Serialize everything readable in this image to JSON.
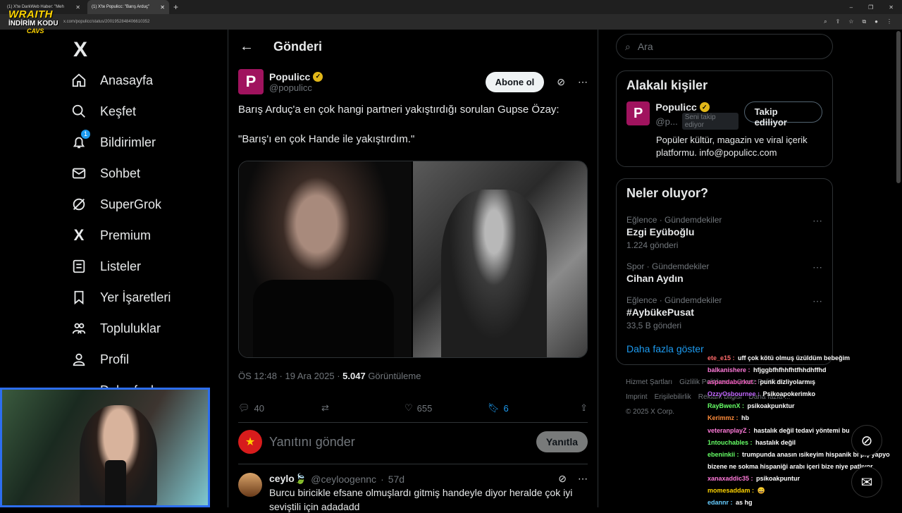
{
  "browser": {
    "tabs": [
      {
        "title": "(1) X'te DarkWeb Haber: \"Meh"
      },
      {
        "title": "(1) X'te Populicc: \"Barış Arduç\""
      }
    ],
    "url": "x.com/populicc/status/2001952848406610352"
  },
  "nav": {
    "logo": "X",
    "items": [
      {
        "label": "Anasayfa",
        "icon": "home-icon"
      },
      {
        "label": "Keşfet",
        "icon": "search-icon"
      },
      {
        "label": "Bildirimler",
        "icon": "bell-icon",
        "badge": "1"
      },
      {
        "label": "Sohbet",
        "icon": "mail-icon"
      },
      {
        "label": "SuperGrok",
        "icon": "grok-icon"
      },
      {
        "label": "Premium",
        "icon": "x-icon"
      },
      {
        "label": "Listeler",
        "icon": "list-icon"
      },
      {
        "label": "Yer İşaretleri",
        "icon": "bookmark-icon"
      },
      {
        "label": "Topluluklar",
        "icon": "people-icon"
      },
      {
        "label": "Profil",
        "icon": "person-icon"
      },
      {
        "label": "Daha fazla",
        "icon": "more-icon"
      }
    ]
  },
  "header": {
    "title": "Gönderi"
  },
  "post": {
    "author_name": "Populicc",
    "author_handle": "@populicc",
    "subscribe_label": "Abone ol",
    "text_line1": "Barış Arduç'a en çok hangi partneri yakıştırdığı sorulan Gupse Özay:",
    "text_line2": "\"Barış'ı en çok Hande ile yakıştırdım.\"",
    "time": "ÖS 12:48 · 19 Ara 2025 · ",
    "views_count": "5.047",
    "views_label": " Görüntüleme",
    "replies": "40",
    "reposts": "",
    "likes": "655",
    "bookmarks": "6"
  },
  "reply_box": {
    "placeholder": "Yanıtını gönder",
    "button": "Yanıtla"
  },
  "comment": {
    "name": "ceylo🍃",
    "handle": "@ceyloogennc",
    "age": "57d",
    "text": "Burcu biricikle efsane olmuşlardı gitmiş handeyle diyor heralde çok iyi",
    "text2": "seviştili için adadadd"
  },
  "right": {
    "search_placeholder": "Ara",
    "related_title": "Alakalı kişiler",
    "related": {
      "name": "Populicc",
      "handle": "@p...",
      "follows_you": "Seni takip ediyor",
      "follow_label": "Takip ediliyor",
      "bio": "Popüler kültür, magazin ve viral içerik platformu. info@populicc.com"
    },
    "trends_title": "Neler oluyor?",
    "trends": [
      {
        "category": "Eğlence · Gündemdekiler",
        "name": "Ezgi Eyüboğlu",
        "count": "1.224 gönderi"
      },
      {
        "category": "Spor · Gündemdekiler",
        "name": "Cihan Aydın",
        "count": ""
      },
      {
        "category": "Eğlence · Gündemdekiler",
        "name": "#AybükePusat",
        "count": "33,5 B gönderi"
      }
    ],
    "show_more": "Daha fazla göster",
    "footer_lines": [
      [
        "Hizmet Şartları",
        "Gizlilik Politikası",
        "Çerez Politikası"
      ],
      [
        "Imprint",
        "Erişilebilirlik",
        "Reklam bilgisi",
        "Daha fazla ..."
      ],
      [
        "© 2025 X Corp."
      ]
    ]
  },
  "overlay": {
    "brand": "WRAITH",
    "promo": "İNDİRİM KODU",
    "code": "CAVS"
  },
  "chat": [
    {
      "user": "ete_e15",
      "color": "#ff6a6a",
      "msg": "uff çok kötü olmuş üzüldüm bebeğim"
    },
    {
      "user": "balkanishere",
      "color": "#ff7ad9",
      "msg": "hfjggbfhfhhfhtfhhdhffhd"
    },
    {
      "user": "aspandaburkut",
      "color": "#ff66cc",
      "msg": "punk dizliyolarmış"
    },
    {
      "user": "OzzyOsbournee",
      "color": "#c266ff",
      "msg": "Psikoapokerimko"
    },
    {
      "user": "RayBwenX",
      "color": "#66ff66",
      "msg": "psikoakpunktur"
    },
    {
      "user": "Kerimmz",
      "color": "#ff8c3a",
      "msg": "hb"
    },
    {
      "user": "veteranplayZ",
      "color": "#ff7ad9",
      "msg": "hastalık değil tedavi yöntemi bu"
    },
    {
      "user": "1ntouchables",
      "color": "#66ff66",
      "msg": "hastalık değil"
    },
    {
      "user": "ebeninkii",
      "color": "#66ff66",
      "msg": "trumpunda anasın ısikeyim hispanik bi piç yapyo bizene ne sokma hispaniği arabı içeri bize niye patlıyor"
    },
    {
      "user": "xanaxaddic35",
      "color": "#ff7ad9",
      "msg": "psikoakpuntur"
    },
    {
      "user": "momesaddam",
      "color": "#ffd400",
      "msg": "😄"
    },
    {
      "user": "edannr",
      "color": "#66ccff",
      "msg": "as hg"
    }
  ]
}
